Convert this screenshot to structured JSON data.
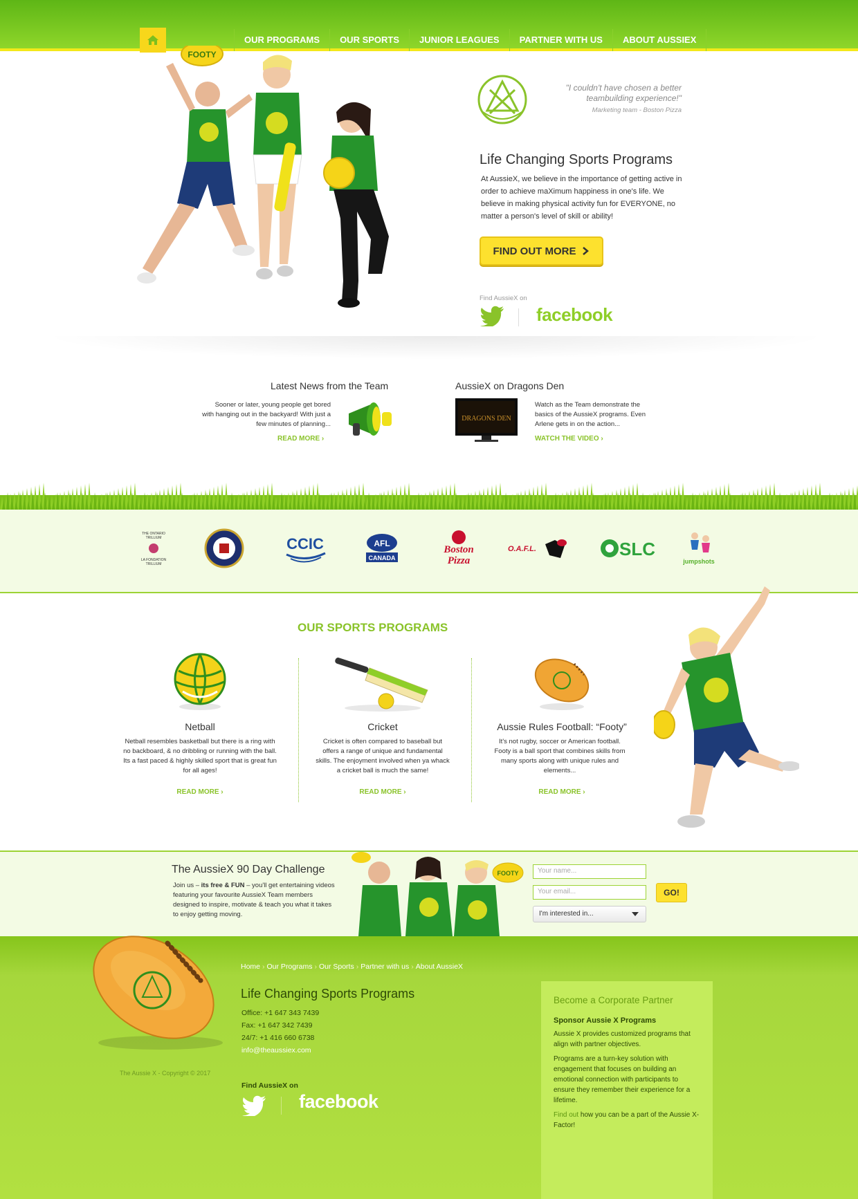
{
  "nav": {
    "home_icon": "home-icon",
    "items": [
      "OUR PROGRAMS",
      "OUR SPORTS",
      "JUNIOR LEAGUES",
      "PARTNER WITH US",
      "ABOUT AUSSIEX"
    ]
  },
  "hero": {
    "ball_label": "FOOTY",
    "quote": "\"I couldn't have chosen a better teambuilding experience!\"",
    "quote_attribution": "Marketing team - Boston Pizza",
    "title": "Life Changing Sports Programs",
    "text": "At AussieX, we believe in the importance of getting active in order to achieve maXimum happiness in one's life. We believe in making physical activity fun for EVERYONE, no matter a person's level of skill or ability!",
    "cta_label": "FIND OUT MORE",
    "find_label": "Find AussieX on",
    "facebook_label": "facebook"
  },
  "news": [
    {
      "title": "Latest News from the Team",
      "text": "Sooner or later, young people get bored with hanging out in the backyard! With just a few minutes of planning...",
      "link": "READ MORE"
    },
    {
      "title": "AussieX on Dragons Den",
      "text": "Watch as the Team demonstrate the basics of the AussieX programs. Even Arlene gets in on the action...",
      "link": "WATCH THE VIDEO"
    }
  ],
  "partners": [
    "The Ontario Trillium Foundation",
    "Toronto",
    "CCIC",
    "AFL Canada",
    "Boston Pizza",
    "O.A.F.L.",
    "OSLC",
    "jumpshots"
  ],
  "sports": {
    "title": "OUR SPORTS PROGRAMS",
    "items": [
      {
        "title": "Netball",
        "text": "Netball resembles basketball but there is a ring with no backboard, & no dribbling or running with the ball. Its a fast paced & highly skilled sport that is great fun for all ages!",
        "link": "READ MORE"
      },
      {
        "title": "Cricket",
        "text": "Cricket is often compared to baseball but offers a range of unique and fundamental skills. The enjoyment involved when ya whack a cricket ball is much the same!",
        "link": "READ MORE"
      },
      {
        "title": "Aussie Rules Football: “Footy”",
        "text": "It's not rugby, soccer or American football. Footy is a ball sport that combines skills from many sports along with unique rules and elements...",
        "link": "READ MORE"
      }
    ]
  },
  "challenge": {
    "title": "The AussieX 90 Day Challenge",
    "text_pre": "Join us – ",
    "text_bold": "its free & FUN",
    "text_post": " – you'll get entertaining videos featuring your favourite AussieX Team members designed to inspire, motivate & teach you what it takes to enjoy getting moving.",
    "name_placeholder": "Your name...",
    "email_placeholder": "Your email...",
    "select_value": "I'm interested in...",
    "go_label": "GO!",
    "ball_label": "FOOTY"
  },
  "footer": {
    "links": [
      "Home",
      "Our Programs",
      "Our Sports",
      "Partner with us",
      "About AussieX"
    ],
    "copyright": "The Aussie X - Copyright © 2017",
    "title": "Life Changing Sports Programs",
    "office": "Office: +1 647 343 7439",
    "fax": "Fax: +1 647 342 7439",
    "hotline": "24/7: +1 416 660 6738",
    "email": "info@theaussiex.com",
    "find_label": "Find AussieX on",
    "facebook_label": "facebook",
    "corporate": {
      "title": "Become a Corporate Partner",
      "subtitle": "Sponsor Aussie X Programs",
      "p1": "Aussie X provides customized programs that align with partner objectives.",
      "p2": "Programs are a turn-key solution with engagement that focuses on building an emotional connection with participants to ensure they remember their experience for a lifetime.",
      "p3_highlight": "Find out",
      "p3_rest": " how you can be a part of the Aussie X-Factor!"
    }
  },
  "colors": {
    "green": "#8ac32a",
    "yellow": "#fde12e",
    "dark_text": "#333333"
  }
}
